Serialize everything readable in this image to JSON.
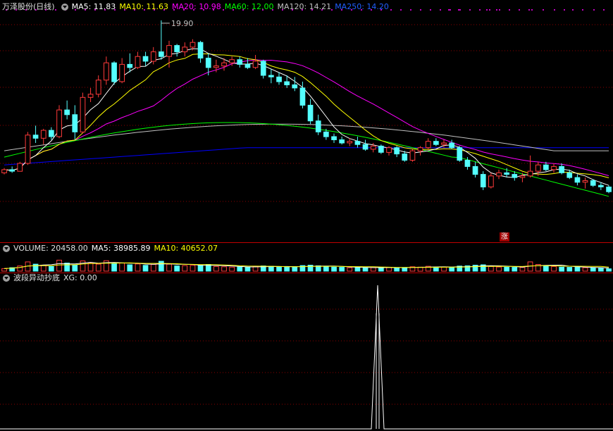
{
  "stock": {
    "name": "万泽股份(日线)",
    "ma5": "MA5: 11.83",
    "ma10": "MA10: 11.63",
    "ma20": "MA20: 10.98",
    "ma60": "MA60: 12.00",
    "ma120": "MA120: 14.21",
    "ma250": "MA250: 14.20",
    "high_label": "19.90"
  },
  "volume": {
    "title": "VOLUME: 20458.00",
    "ma5": "MA5: 38985.89",
    "ma10": "MA10: 40652.07"
  },
  "indicator": {
    "title": "波段异动抄底",
    "xg": "XG: 0.00"
  },
  "marker": {
    "zhang": "涨"
  },
  "colors": {
    "up": "#ff3a3a",
    "down": "#54ffff",
    "ma5": "#ffffff",
    "ma10": "#ffff00",
    "ma20": "#ff00ff",
    "ma60": "#00ff00",
    "ma120": "#c0c0c0",
    "ma250": "#0000ff",
    "grid": "#8b0000"
  },
  "chart_data": {
    "type": "candlestick",
    "candles": [
      [
        10.2,
        10.5,
        10.1,
        10.4
      ],
      [
        10.4,
        10.6,
        10.2,
        10.3
      ],
      [
        10.3,
        10.9,
        10.3,
        10.8
      ],
      [
        10.8,
        12.8,
        10.7,
        12.6
      ],
      [
        12.6,
        13.2,
        12.1,
        12.4
      ],
      [
        12.4,
        13.0,
        12.0,
        12.9
      ],
      [
        12.9,
        13.1,
        12.3,
        12.5
      ],
      [
        12.5,
        14.5,
        12.4,
        14.2
      ],
      [
        14.2,
        14.8,
        13.6,
        13.9
      ],
      [
        13.9,
        14.5,
        12.3,
        12.8
      ],
      [
        12.8,
        15.3,
        12.7,
        15.0
      ],
      [
        15.0,
        15.6,
        14.7,
        15.2
      ],
      [
        15.2,
        16.4,
        15.0,
        16.1
      ],
      [
        16.1,
        17.6,
        15.8,
        17.2
      ],
      [
        17.2,
        17.3,
        15.8,
        16.0
      ],
      [
        16.0,
        17.5,
        15.9,
        17.1
      ],
      [
        17.1,
        17.8,
        16.6,
        16.9
      ],
      [
        16.9,
        17.9,
        16.8,
        17.6
      ],
      [
        17.6,
        17.9,
        17.0,
        17.3
      ],
      [
        17.3,
        18.2,
        17.1,
        17.9
      ],
      [
        17.9,
        19.9,
        17.4,
        17.6
      ],
      [
        17.6,
        18.6,
        16.9,
        18.3
      ],
      [
        18.3,
        18.4,
        17.6,
        17.9
      ],
      [
        17.9,
        18.5,
        17.6,
        18.2
      ],
      [
        18.2,
        18.7,
        18.0,
        18.5
      ],
      [
        18.5,
        18.6,
        17.2,
        17.5
      ],
      [
        17.5,
        17.8,
        16.4,
        16.9
      ],
      [
        16.9,
        17.4,
        16.6,
        17.0
      ],
      [
        17.0,
        17.5,
        16.7,
        17.2
      ],
      [
        17.2,
        17.6,
        17.0,
        17.4
      ],
      [
        17.4,
        17.6,
        16.9,
        17.1
      ],
      [
        17.1,
        17.5,
        16.8,
        16.9
      ],
      [
        16.9,
        17.7,
        16.8,
        17.3
      ],
      [
        17.3,
        17.4,
        16.2,
        16.4
      ],
      [
        16.4,
        16.8,
        15.9,
        16.3
      ],
      [
        16.3,
        16.6,
        15.8,
        16.0
      ],
      [
        16.0,
        16.4,
        15.6,
        15.8
      ],
      [
        15.8,
        16.3,
        15.4,
        15.6
      ],
      [
        15.6,
        16.0,
        14.3,
        14.5
      ],
      [
        14.5,
        14.9,
        13.3,
        13.5
      ],
      [
        13.5,
        13.9,
        12.6,
        12.8
      ],
      [
        12.8,
        13.0,
        12.3,
        12.5
      ],
      [
        12.5,
        12.7,
        12.1,
        12.3
      ],
      [
        12.3,
        12.5,
        12.0,
        12.1
      ],
      [
        12.1,
        12.4,
        11.9,
        12.2
      ],
      [
        12.2,
        12.5,
        11.8,
        12.0
      ],
      [
        12.0,
        12.3,
        11.6,
        11.7
      ],
      [
        11.7,
        12.1,
        11.5,
        11.9
      ],
      [
        11.9,
        12.0,
        11.4,
        11.5
      ],
      [
        11.5,
        11.9,
        11.3,
        11.8
      ],
      [
        11.8,
        11.9,
        11.2,
        11.4
      ],
      [
        11.4,
        11.6,
        10.9,
        11.0
      ],
      [
        11.0,
        11.7,
        10.9,
        11.6
      ],
      [
        11.6,
        11.9,
        11.3,
        11.8
      ],
      [
        11.8,
        12.4,
        11.7,
        12.2
      ],
      [
        12.2,
        12.4,
        11.9,
        12.0
      ],
      [
        12.0,
        12.3,
        11.8,
        12.1
      ],
      [
        12.1,
        12.3,
        11.7,
        11.8
      ],
      [
        11.8,
        11.9,
        10.9,
        11.0
      ],
      [
        11.0,
        11.2,
        10.4,
        10.6
      ],
      [
        10.6,
        10.9,
        9.9,
        10.1
      ],
      [
        10.1,
        10.3,
        9.1,
        9.3
      ],
      [
        9.3,
        10.2,
        9.2,
        10.0
      ],
      [
        10.0,
        10.4,
        9.8,
        10.2
      ],
      [
        10.2,
        10.5,
        9.9,
        10.1
      ],
      [
        10.1,
        10.3,
        9.7,
        9.9
      ],
      [
        9.9,
        10.2,
        9.6,
        10.0
      ],
      [
        10.0,
        11.3,
        9.9,
        10.3
      ],
      [
        10.3,
        10.9,
        10.0,
        10.7
      ],
      [
        10.7,
        10.9,
        10.3,
        10.4
      ],
      [
        10.4,
        10.8,
        10.2,
        10.6
      ],
      [
        10.6,
        10.8,
        10.1,
        10.2
      ],
      [
        10.2,
        10.4,
        9.8,
        9.9
      ],
      [
        9.9,
        10.1,
        9.4,
        9.6
      ],
      [
        9.6,
        9.9,
        9.2,
        9.7
      ],
      [
        9.7,
        9.8,
        9.3,
        9.4
      ],
      [
        9.4,
        9.6,
        9.1,
        9.3
      ],
      [
        9.3,
        9.4,
        8.9,
        9.0
      ]
    ],
    "volume": [
      22,
      30,
      45,
      80,
      60,
      52,
      40,
      95,
      70,
      55,
      88,
      72,
      60,
      90,
      66,
      70,
      55,
      62,
      50,
      58,
      85,
      60,
      45,
      48,
      50,
      52,
      58,
      40,
      38,
      35,
      36,
      34,
      40,
      45,
      42,
      38,
      36,
      35,
      48,
      52,
      46,
      40,
      35,
      33,
      30,
      32,
      31,
      30,
      29,
      33,
      30,
      31,
      38,
      35,
      42,
      36,
      34,
      32,
      44,
      46,
      52,
      55,
      40,
      36,
      34,
      33,
      32,
      80,
      58,
      46,
      40,
      35,
      33,
      34,
      30,
      28,
      26,
      20
    ],
    "xg_spike_index": 536,
    "indicator_xg": 0.0
  }
}
